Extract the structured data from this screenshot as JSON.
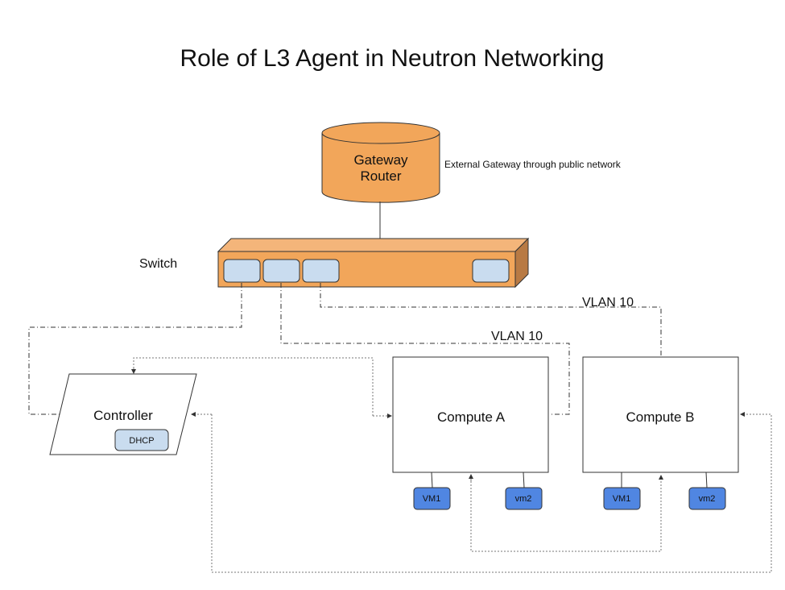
{
  "title": "Role of L3 Agent in Neutron Networking",
  "colors": {
    "orange": "#f2a65a",
    "orange_top": "#f4b57a",
    "orange_side": "#b87a44",
    "port": "#c9dcef",
    "vm": "#5086e2",
    "dhcp": "#c9dcef"
  },
  "nodes": {
    "gateway": {
      "line1": "Gateway",
      "line2": "Router",
      "annotation": "External Gateway through public network"
    },
    "switch": {
      "label": "Switch",
      "port_count": 4
    },
    "controller": {
      "label": "Controller",
      "service": "DHCP"
    },
    "compute_a": {
      "label": "Compute A",
      "vms": [
        "VM1",
        "vm2"
      ]
    },
    "compute_b": {
      "label": "Compute B",
      "vms": [
        "VM1",
        "vm2"
      ]
    }
  },
  "links": {
    "vlan_a": "VLAN 10",
    "vlan_b": "VLAN 10"
  }
}
